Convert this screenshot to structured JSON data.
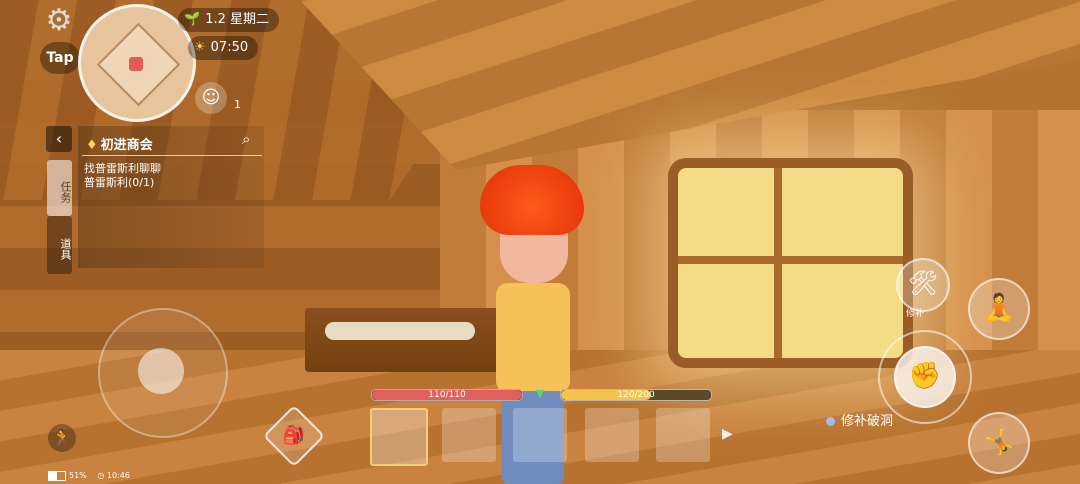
{
  "hud": {
    "settings_icon": "gear-icon",
    "tap_label": "Tap",
    "date": "1.2 星期二",
    "time": "07:50",
    "friend_count": "1"
  },
  "quest": {
    "title": "初进商会",
    "line1": "找普雷斯利聊聊",
    "line2": "普雷斯利(0/1)",
    "tabs": [
      "任务",
      "道具"
    ]
  },
  "stats": {
    "hp_text": "110/110",
    "hp_fraction": 1.0,
    "sp_text": "120/200",
    "sp_fraction": 0.6
  },
  "hotbar": {
    "slot_count": 6,
    "selected_index": 0
  },
  "actions": {
    "repair_label": "修补",
    "hint_text": "修补破洞"
  },
  "device": {
    "battery": "51%",
    "clock": "10:46"
  },
  "colors": {
    "hp": "#e06060",
    "sp": "#f3c34e",
    "hair": "#e13006"
  }
}
